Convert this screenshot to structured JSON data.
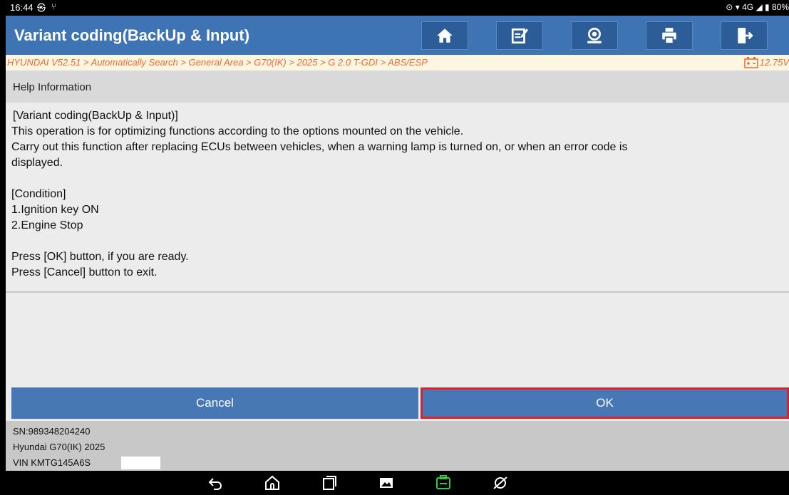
{
  "status_bar": {
    "time": "16:44",
    "battery": "80%",
    "network": "4G"
  },
  "header": {
    "title": "Variant coding(BackUp & Input)"
  },
  "toolbar": {
    "icons": [
      "home-icon",
      "edit-icon",
      "support-icon",
      "print-icon",
      "exit-icon"
    ]
  },
  "breadcrumb": {
    "path": "HYUNDAI V52.51 > Automatically Search > General Area > G70(IK) > 2025 > G 2.0 T-GDI > ABS/ESP",
    "voltage": "12.75V"
  },
  "help": {
    "header": "Help Information",
    "lines": [
      "[Variant coding(BackUp & Input)]",
      "This operation is for optimizing functions according to the options mounted on the vehicle.",
      "Carry out this function after replacing ECUs between vehicles, when a warning lamp is turned on, or when an error code is",
      "displayed.",
      "",
      "[Condition]",
      "1.Ignition key ON",
      "2.Engine Stop",
      "",
      "Press [OK] button, if you are ready.",
      "Press [Cancel] button to exit."
    ]
  },
  "buttons": {
    "cancel": "Cancel",
    "ok": "OK"
  },
  "info": {
    "sn": "SN:989348204240",
    "vehicle": "Hyundai G70(IK) 2025",
    "vin": "VIN KMTG145A6S"
  },
  "colors": {
    "title_bar": "#3e74b3",
    "button": "#4777b4",
    "breadcrumb_text": "#ef6a2e",
    "ok_highlight": "#d9232f"
  }
}
